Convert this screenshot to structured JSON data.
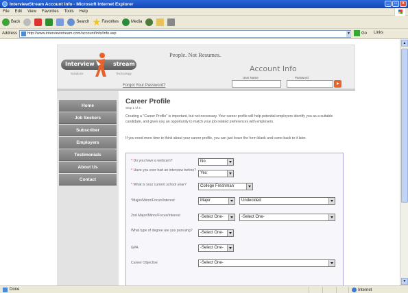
{
  "window": {
    "title": "InterviewStream Account Info - Microsoft Internet Explorer",
    "menu": [
      "File",
      "Edit",
      "View",
      "Favorites",
      "Tools",
      "Help"
    ],
    "toolbar": {
      "back": "Back",
      "search": "Search",
      "favorites": "Favorites",
      "media": "Media"
    },
    "address_label": "Address",
    "address": "http://www.interviewstream.com/account/info/Info.asp",
    "go": "Go",
    "links": "Links",
    "status": "Done",
    "zone": "Internet"
  },
  "header": {
    "logo_left": "Interview",
    "logo_right": "stream",
    "logo_sub_left": "Solutions",
    "logo_sub_right": "Technology",
    "tagline": "People. Not Resumes.",
    "account_title": "Account Info",
    "forgot_link": "Forgot Your Password?",
    "username_label": "User Name",
    "password_label": "Password"
  },
  "nav": [
    "Home",
    "Job Seekers",
    "Subscriber",
    "Employers",
    "Testimonials",
    "About Us",
    "Contact"
  ],
  "content": {
    "title": "Career Profile",
    "step": "Step 1 of 4",
    "para1": "Creating a \"Career Profile\" is important, but not necessary. Your career profile will help potential employers identify you as a suitable candidate, and gives you an opportunity to match your job related preferences with employers.",
    "para2": "If you need more time to think about your career profile, you can just leave the form blank and come back to it later."
  },
  "form": {
    "webcam_label": "Do you have a webcam?",
    "webcam_value": "No",
    "interview_label": "Have you ever had an interview before?",
    "interview_value": "Yes",
    "school_label": "What is your current school year?",
    "school_value": "College Freshman",
    "major_label": "*Major/Minor/Focus/Interest",
    "major_type": "Major",
    "major_value": "Undecided",
    "second_major_label": "2nd Major/Minor/Focus/Interest",
    "second_major_type": "-Select One-",
    "second_major_value": "-Select One-",
    "degree_label": "What type of degree are you pursuing?",
    "degree_value": "-Select One-",
    "gpa_label": "GPA",
    "gpa_value": "-Select One-",
    "career_label": "Career Objective",
    "career_value": "-Select One-"
  }
}
